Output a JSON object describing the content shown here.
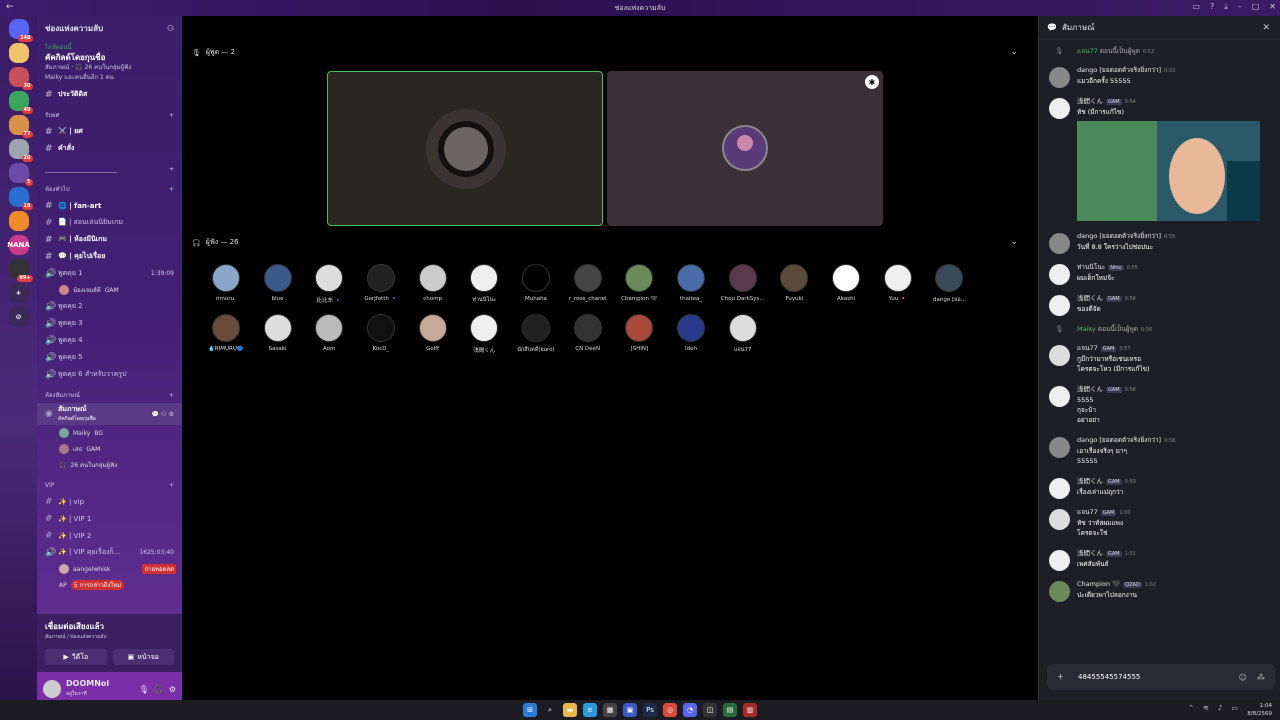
{
  "window": {
    "title": "ช่องแห่งความลับ"
  },
  "servers": [
    {
      "label": "",
      "color": "#5865f2",
      "badge": "148"
    },
    {
      "label": "",
      "color": "#f0c36b",
      "badge": ""
    },
    {
      "label": "",
      "color": "#c7505a",
      "badge": "30"
    },
    {
      "label": "",
      "color": "#3aa55d",
      "badge": "49"
    },
    {
      "label": "",
      "color": "#d9904a",
      "badge": "77"
    },
    {
      "label": "",
      "color": "#9ea3b0",
      "badge": "20"
    },
    {
      "label": "",
      "color": "#6b4aa8",
      "badge": "5"
    },
    {
      "label": "",
      "color": "#2a6fcf",
      "badge": "18"
    },
    {
      "label": "",
      "color": "#f08a2a",
      "badge": ""
    },
    {
      "label": "NANA",
      "color": "#c93a8a",
      "badge": ""
    },
    {
      "label": "",
      "color": "#333",
      "badge": "99+"
    },
    {
      "label": "+",
      "color": "#3b2a5a",
      "badge": ""
    },
    {
      "label": "⊘",
      "color": "#3b2a5a",
      "badge": ""
    }
  ],
  "sidebar": {
    "server_name": "ช่องแห่งความลับ",
    "event": {
      "live": "ไลฟ์ตอนนี้",
      "title": "คัคกิลด์โดยกุนชื่อ",
      "line1": "สัมภาษณ์ · 🎧 26 คนในกลุ่มผู้ฟัง",
      "line2": "Maiky และคนอื่นอีก 1 คน"
    },
    "top_channels": [
      {
        "name": "ประวัติดิส"
      }
    ],
    "cat1": "รับยศ",
    "cat1_channels": [
      {
        "name": "⚔️ | ยศ"
      },
      {
        "name": "คำสั่ง"
      }
    ],
    "cat2": "________________________",
    "cat3": "ห้องทั่วไป",
    "cat3_channels": [
      {
        "name": "🌐 | fan-art"
      },
      {
        "name": "📄 | สอนเล่นนิยิมเกม"
      },
      {
        "name": "🎮 | ห้องมีนิเกม"
      },
      {
        "name": "💬 | คุยไปเรื่อย"
      }
    ],
    "voice": [
      {
        "name": "พูดคุย 1",
        "time": "1:39:09"
      }
    ],
    "voice_member": {
      "name": "น้องเจมส์ดี",
      "tag": "GAM"
    },
    "voice_more": [
      {
        "name": "พูดคุย 2"
      },
      {
        "name": "พูดคุย 3"
      },
      {
        "name": "พูดคุย 4"
      },
      {
        "name": "พูดคุย 5"
      },
      {
        "name": "พูดคุย 6 สำหรับวาครูป"
      }
    ],
    "cat4": "ห้องสัมภาษณ์",
    "stage": {
      "name": "สัมภาษณ์",
      "sub": "คัคกิลด์โดยกุนชื่อ"
    },
    "stage_members": [
      {
        "name": "Maiky",
        "tag": "BG"
      },
      {
        "name": "เสธ",
        "tag": "GAM"
      }
    ],
    "stage_listeners": "26 คนในกลุ่มผู้ฟัง",
    "cat5": "VIP",
    "vip_channels": [
      {
        "name": "✨ | vip"
      },
      {
        "name": "✨ | VIP 1"
      },
      {
        "name": "✨ | VIP 2"
      }
    ],
    "vip_voice": {
      "name": "✨ | VIP คุยเรื่องก็...",
      "time": "1625:03:40"
    },
    "vip_member": {
      "name": "aangelwhisk",
      "tag": "ถ่ายทอดสด"
    },
    "vip_member2": "AP",
    "new_mentions": "5 การกล่าวถึงใหม่",
    "voice_status": {
      "title": "เชื่อมต่อเสียงแล้ว",
      "sub": "สัมภาษณ์ / ช่องแห่งความลับ",
      "video": "วีดีโอ",
      "screen": "หน้าจอ"
    },
    "user": {
      "name": "DOOMNol",
      "status": "อยู่ในวาที"
    }
  },
  "stage": {
    "speakers_label": "ผู้พูด — 2",
    "listeners_label": "ผู้ฟัง — 26",
    "listeners": [
      {
        "name": "rimuru.",
        "color": "#8aa6c8"
      },
      {
        "name": "blue",
        "color": "#3a5a8a"
      },
      {
        "name": "比比东 🔹",
        "color": "#ddd"
      },
      {
        "name": "Gorjfotth 🔹",
        "color": "#222"
      },
      {
        "name": "chomp",
        "color": "#ccc"
      },
      {
        "name": "ท่านนิโนะ",
        "color": "#eee"
      },
      {
        "name": "Muhaha",
        "color": "#000"
      },
      {
        "name": "r_rose_chanel",
        "color": "#444"
      },
      {
        "name": "Champion 🖤",
        "color": "#6a8a5a"
      },
      {
        "name": "thaitea_",
        "color": "#4a6aa8"
      },
      {
        "name": "Chou DarkSys...",
        "color": "#5a3a4a"
      },
      {
        "name": "Fuyuki",
        "color": "#5a4a3a"
      },
      {
        "name": "Akashi",
        "color": "#fff"
      },
      {
        "name": "Yuu 🔸",
        "color": "#eee"
      },
      {
        "name": "dango [ยอ...",
        "color": "#3a4a5a"
      },
      {
        "name": "💧RIMURU🔵",
        "color": "#6a4a3a"
      },
      {
        "name": "Sasaki",
        "color": "#ddd"
      },
      {
        "name": "Aom",
        "color": "#bbb"
      },
      {
        "name": "KocD_",
        "color": "#111"
      },
      {
        "name": "Golff",
        "color": "#c8a898"
      },
      {
        "name": "浅間くん",
        "color": "#eee"
      },
      {
        "name": "นักสืบคดี(kuro)",
        "color": "#222"
      },
      {
        "name": "CN DeeN",
        "color": "#333"
      },
      {
        "name": "[SHIN]",
        "color": "#a84a3a"
      },
      {
        "name": "Iden",
        "color": "#2a3a8a"
      },
      {
        "name": "แจน77",
        "color": "#ddd"
      }
    ]
  },
  "chat": {
    "title": "สัมภาษณ์",
    "input_value": "48455545574555",
    "messages": [
      {
        "sys": true,
        "name": "แจน77",
        "text": "ตอนนี้เป็นผู้พูด",
        "time": "0:53"
      },
      {
        "name": "dango [ยอดอดตัวจริงยิ่งกว่า]",
        "time": "0:53",
        "lines": [
          "แมวอีกครั้ง 55555"
        ],
        "color": "#888"
      },
      {
        "name": "浅間くん",
        "tag": "GAM",
        "time": "0:54",
        "lines": [
          "ทัช (มีการแก้ไข)"
        ],
        "color": "#eee"
      },
      {
        "name": "dango [ยอดอดตัวจริงยิ่งกว่า]",
        "time": "0:55",
        "lines": [
          "วันที่ 8.8 ใครว่างไปช่อปนะ"
        ],
        "color": "#888"
      },
      {
        "name": "ท่านนิโนะ",
        "tag": "Nino",
        "time": "0:55",
        "lines": [
          "ผมเด็กใหม่จ้ะ"
        ],
        "color": "#eee"
      },
      {
        "name": "浅間くん",
        "tag": "GAM",
        "time": "0:56",
        "lines": [
          "ของดีจัด"
        ],
        "color": "#eee"
      },
      {
        "sys": true,
        "name": "Maiky",
        "text": "ตอนนี้เป็นผู้พูด",
        "time": "0:56"
      },
      {
        "name": "แจน77",
        "tag": "GAM",
        "time": "0:57",
        "lines": [
          "กูมีกว่ามาหรือเช่นเหรอ",
          "โครตจะโหว (มีการแก้ไข)"
        ],
        "color": "#ddd"
      },
      {
        "name": "浅間くん",
        "tag": "GAM",
        "time": "0:58",
        "lines": [
          "5555",
          "กุจะบ้า",
          "อย่าอย่า"
        ],
        "color": "#eee"
      },
      {
        "name": "dango [ยอดอดตัวจริงยิ่งกว่า]",
        "time": "0:58",
        "lines": [
          "เอาเรื่องจริงๆ มาๆ",
          "55555"
        ],
        "color": "#888"
      },
      {
        "name": "浅間くん",
        "tag": "GAM",
        "time": "0:59",
        "lines": [
          "เรื่องเล่าแม่ถุกว่า"
        ],
        "color": "#eee"
      },
      {
        "name": "แจน77",
        "tag": "GAM",
        "time": "1:00",
        "lines": [
          "ทัช ว่าทัสผมแพง",
          "โครตจะใช่"
        ],
        "color": "#ddd"
      },
      {
        "name": "浅間くん",
        "tag": "GAM",
        "time": "1:01",
        "lines": [
          "เพศสัมพันธ์"
        ],
        "color": "#eee"
      },
      {
        "name": "Champion 🖤",
        "tag": "QZAD",
        "time": "1:02",
        "lines": [
          "ปะเดียวพาไปลอกงาน"
        ],
        "color": "#6a8a5a"
      }
    ]
  },
  "taskbar": {
    "time": "1:04",
    "date": "8/8/2569"
  }
}
